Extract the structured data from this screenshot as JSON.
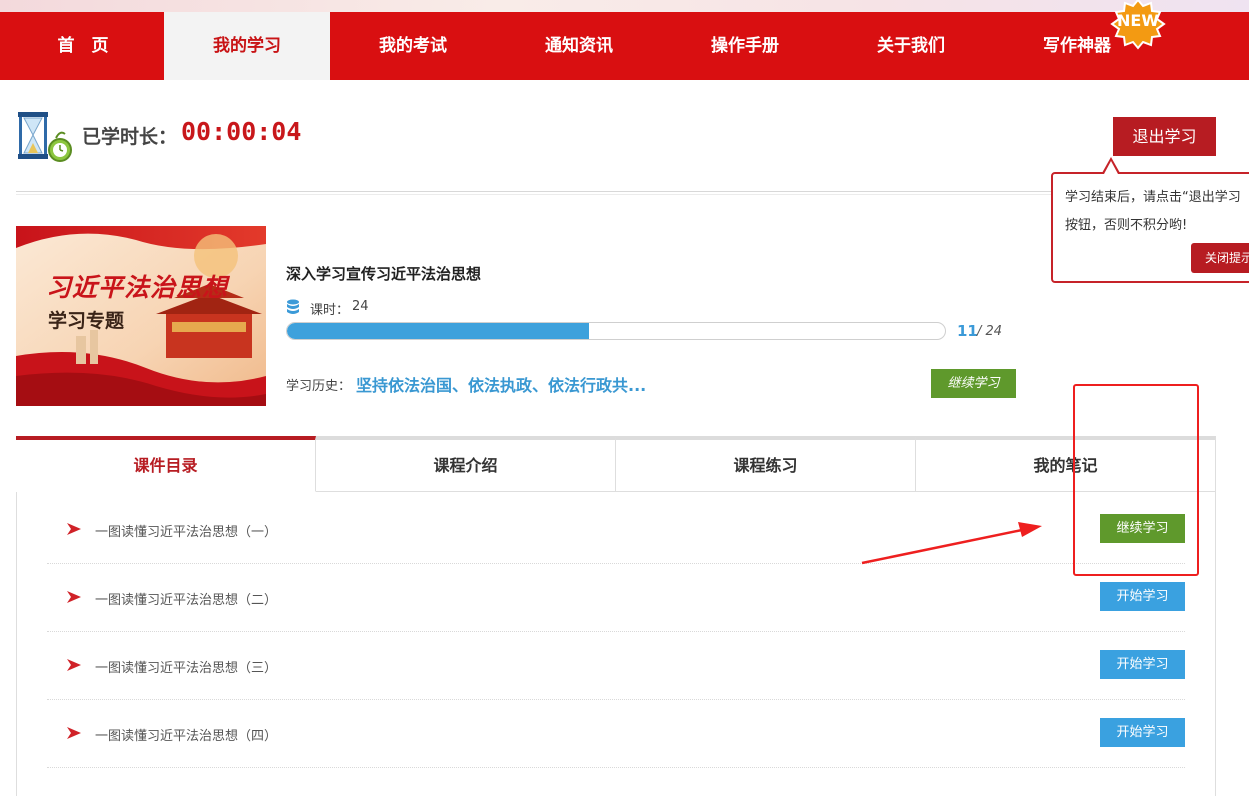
{
  "nav": {
    "items": [
      "首　页",
      "我的学习",
      "我的考试",
      "通知资讯",
      "操作手册",
      "关于我们",
      "写作神器"
    ],
    "active_index": 1,
    "new_badge": "NEW"
  },
  "timer": {
    "label": "已学时长：",
    "value": "00:00:04"
  },
  "exit_button": "退出学习",
  "tooltip": {
    "line1": "学习结束后，请点击“退出学习",
    "line2": "按钮，否则不积分哟!",
    "close_button": "关闭提示"
  },
  "course": {
    "cover_title": "习近平法治思想",
    "cover_subtitle": "学习专题",
    "title": "深入学习宣传习近平法治思想",
    "hours_label": "课时：",
    "hours_value": "24",
    "progress_done": "11",
    "progress_total": "/ 24",
    "progress_fraction": 0.4583,
    "history_label": "学习历史：",
    "history_link": "坚持依法治国、依法执政、依法行政共...",
    "continue_button": "继续学习"
  },
  "tabs": [
    {
      "label": "课件目录",
      "active": true
    },
    {
      "label": "课程介绍",
      "active": false
    },
    {
      "label": "课程练习",
      "active": false
    },
    {
      "label": "我的笔记",
      "active": false
    }
  ],
  "lessons": [
    {
      "title": "一图读懂习近平法治思想（一）",
      "button": "继续学习",
      "button_color": "green"
    },
    {
      "title": "一图读懂习近平法治思想（二）",
      "button": "开始学习",
      "button_color": "blue"
    },
    {
      "title": "一图读懂习近平法治思想（三）",
      "button": "开始学习",
      "button_color": "blue"
    },
    {
      "title": "一图读懂习近平法治思想（四）",
      "button": "开始学习",
      "button_color": "blue"
    }
  ],
  "colors": {
    "nav_red": "#d90f11",
    "accent_red": "#b71c22",
    "green": "#5f992c",
    "blue": "#3aa1e0",
    "annotation_red": "#ee1f1f"
  },
  "icons": [
    "hourglass-timer-icon",
    "database-icon",
    "arrow-bullet-icon",
    "new-starburst-icon"
  ]
}
